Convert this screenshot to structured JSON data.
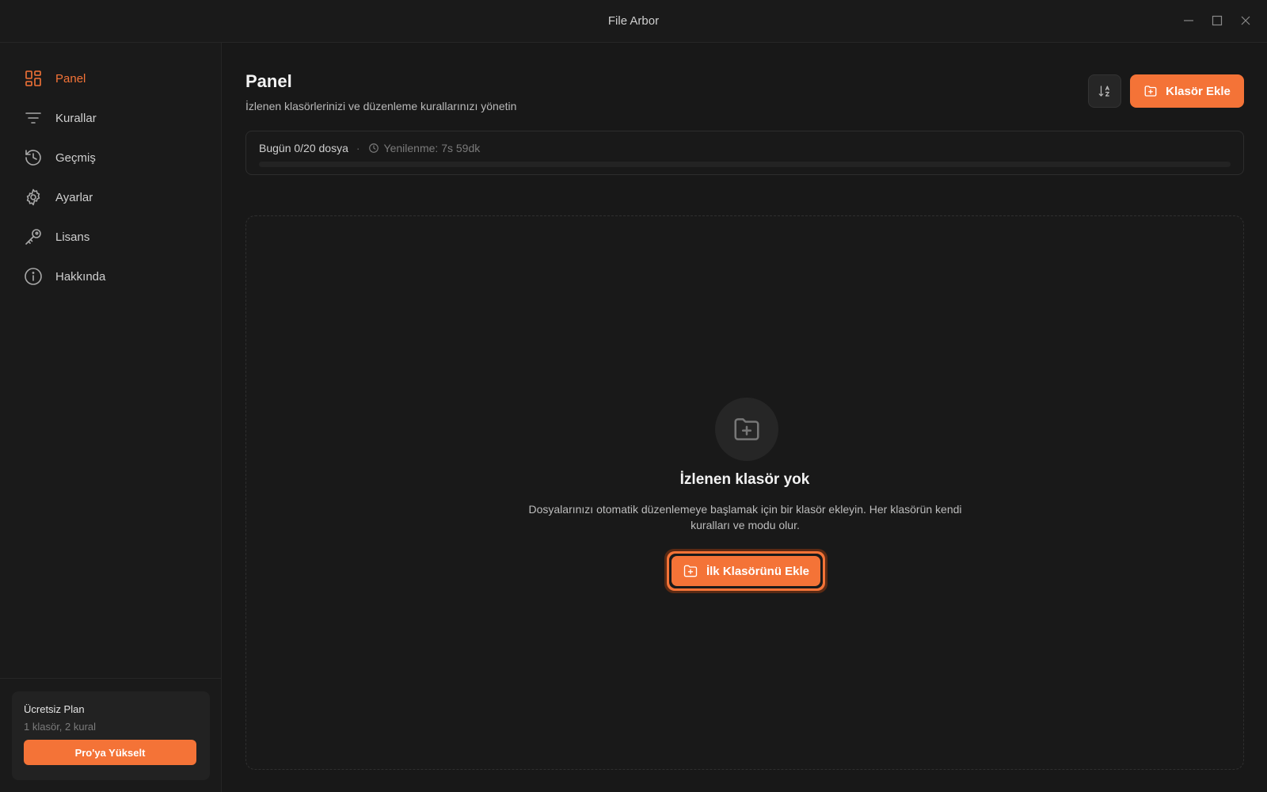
{
  "window": {
    "title": "File Arbor",
    "controls": [
      "minimize-icon",
      "maximize-icon",
      "close-icon"
    ]
  },
  "sidebar": {
    "items": [
      {
        "label": "Panel",
        "icon": "dashboard-grid-icon",
        "active": true
      },
      {
        "label": "Kurallar",
        "icon": "filter-lines-icon",
        "active": false
      },
      {
        "label": "Geçmiş",
        "icon": "history-icon",
        "active": false
      },
      {
        "label": "Ayarlar",
        "icon": "gear-icon",
        "active": false
      },
      {
        "label": "Lisans",
        "icon": "key-icon",
        "active": false
      },
      {
        "label": "Hakkında",
        "icon": "info-icon",
        "active": false
      }
    ],
    "plan": {
      "title": "Ücretsiz Plan",
      "limits": "1 klasör, 2 kural",
      "upgrade_label": "Pro'ya Yükselt"
    }
  },
  "main": {
    "title": "Panel",
    "subtitle": "İzlenen klasörlerinizi ve düzenleme kurallarınızı yönetin",
    "sort_icon": "sort-az-icon",
    "add_folder_label": "Klasör Ekle",
    "usage": {
      "count_text": "Bugün 0/20 dosya",
      "separator": "·",
      "reset_text": "Yenilenme: 7s 59dk",
      "progress_fraction": 0
    },
    "empty": {
      "icon": "folder-plus-icon",
      "title": "İzlenen klasör yok",
      "description": "Dosyalarınızı otomatik düzenlemeye başlamak için bir klasör ekleyin. Her klasörün kendi kuralları ve modu olur.",
      "button_label": "İlk Klasörünü Ekle"
    }
  },
  "colors": {
    "accent": "#f47337",
    "background": "#181818",
    "sidebar": "#1a1a1a"
  }
}
